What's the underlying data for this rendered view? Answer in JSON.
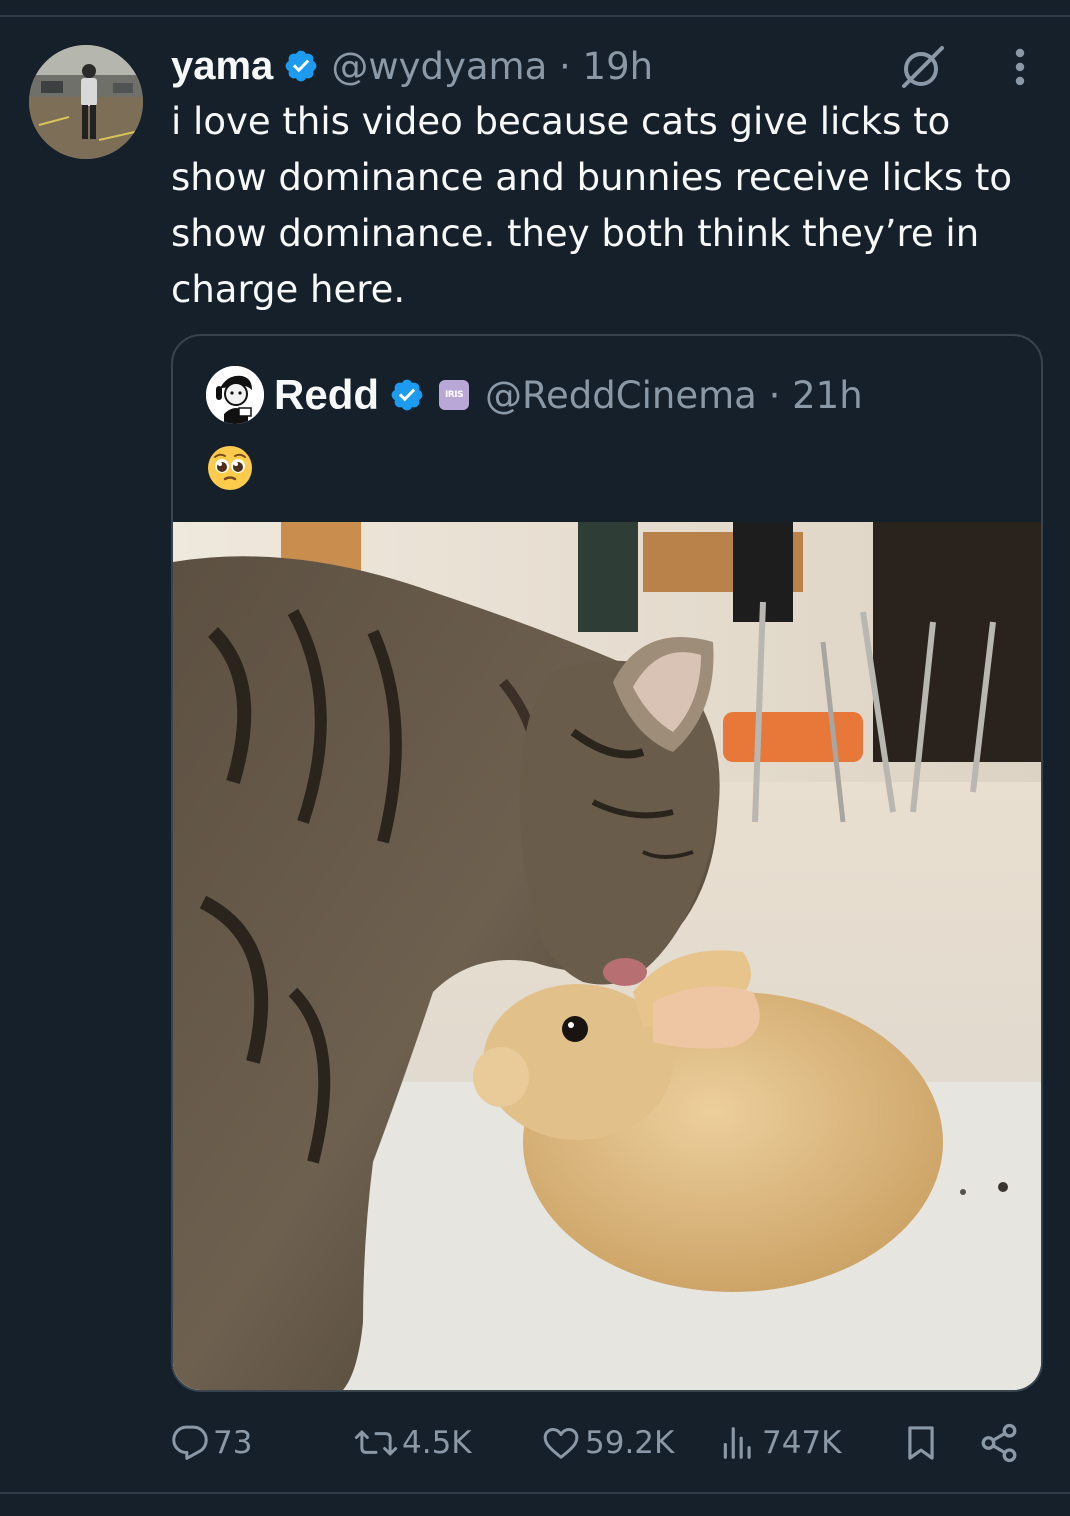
{
  "tweet": {
    "author": {
      "display_name": "yama",
      "handle_time": "@wydyama · 19h"
    },
    "text": "i love this video because cats give licks to\nshow dominance and bunnies receive licks to\nshow dominance. they both think they’re in\ncharge here.",
    "quoted": {
      "display_name": "Redd",
      "affiliate_badge": "IRIS",
      "handle_time": "@ReddCinema · 21h",
      "emoji": "🥹",
      "media": {
        "type": "video",
        "muted": true
      }
    },
    "actions": {
      "replies": "73",
      "reposts": "4.5K",
      "likes": "59.2K",
      "views": "747K"
    }
  },
  "colors": {
    "background": "#15202b",
    "text": "#f7f9f9",
    "secondary_text": "#8b98a5",
    "verified": "#1d9bf0",
    "border": "#38444d"
  },
  "icons": {
    "verified": "verified-badge-icon",
    "grok": "grok-icon",
    "more": "more-dots-icon",
    "mute": "speaker-muted-icon",
    "reply": "reply-bubble-icon",
    "repost": "repost-arrows-icon",
    "like": "heart-icon",
    "views": "bar-chart-icon",
    "bookmark": "bookmark-icon",
    "share": "share-nodes-icon"
  }
}
